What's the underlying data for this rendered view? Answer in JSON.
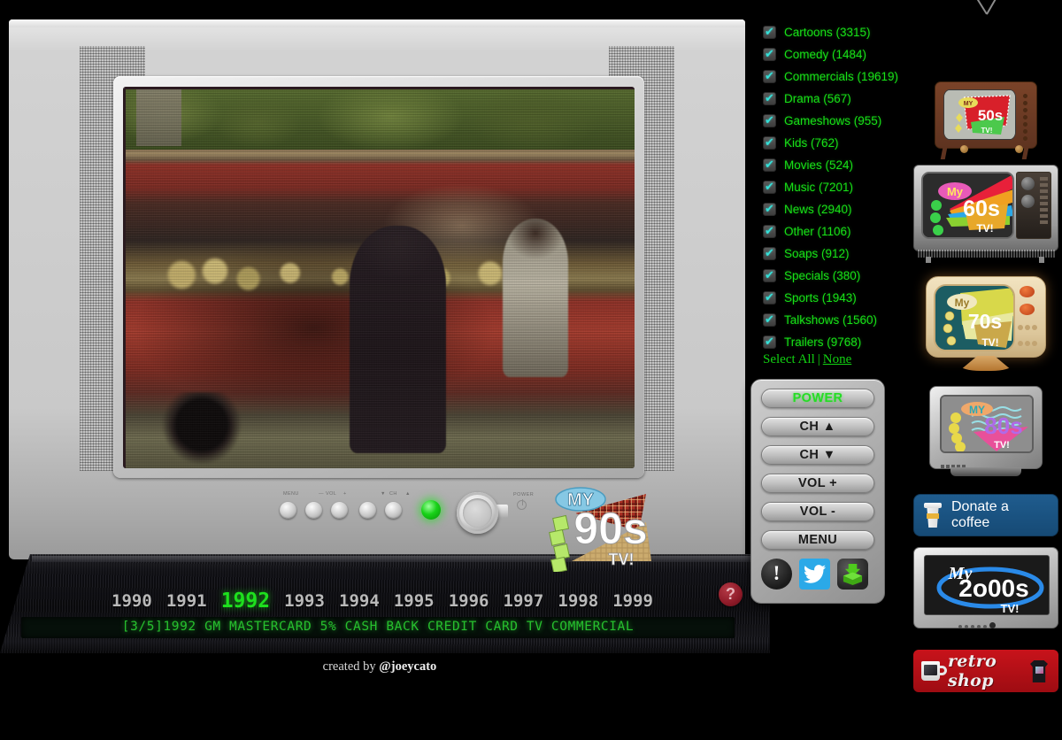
{
  "page": {
    "background_color": "#000000",
    "credit_prefix": "created by ",
    "credit_handle": "@joeycato"
  },
  "tv": {
    "brand_logo": {
      "my": "MY",
      "decade": "90s",
      "tv": "TV!"
    },
    "front_panel": {
      "labels": [
        "-MENU",
        "—  VOL  +",
        "▼   CH   ▲"
      ],
      "label_menu": "MENU",
      "label_vol": "VOL",
      "label_ch": "CH",
      "label_power": "POWER",
      "button_count": 5,
      "led_color": "#19d219",
      "rec_led_color": "#d21a1a"
    },
    "now_playing": "[3/5]1992 GM MASTERCARD 5% CASH BACK CREDIT CARD TV COMMERCIAL",
    "help_label": "?"
  },
  "years": {
    "selected": "1992",
    "items": [
      "1990",
      "1991",
      "1992",
      "1993",
      "1994",
      "1995",
      "1996",
      "1997",
      "1998",
      "1999"
    ],
    "active_color": "#1ee01e",
    "inactive_color": "#b9b9b9"
  },
  "categories": {
    "accent_color": "#18e018",
    "check_color": "#35e0d8",
    "items": [
      {
        "label": "Cartoons (3315)",
        "name": "Cartoons",
        "count": 3315,
        "checked": true
      },
      {
        "label": "Comedy (1484)",
        "name": "Comedy",
        "count": 1484,
        "checked": true
      },
      {
        "label": "Commercials (19619)",
        "name": "Commercials",
        "count": 19619,
        "checked": true
      },
      {
        "label": "Drama (567)",
        "name": "Drama",
        "count": 567,
        "checked": true
      },
      {
        "label": "Gameshows (955)",
        "name": "Gameshows",
        "count": 955,
        "checked": true
      },
      {
        "label": "Kids (762)",
        "name": "Kids",
        "count": 762,
        "checked": true
      },
      {
        "label": "Movies (524)",
        "name": "Movies",
        "count": 524,
        "checked": true
      },
      {
        "label": "Music (7201)",
        "name": "Music",
        "count": 7201,
        "checked": true
      },
      {
        "label": "News (2940)",
        "name": "News",
        "count": 2940,
        "checked": true
      },
      {
        "label": "Other (1106)",
        "name": "Other",
        "count": 1106,
        "checked": true
      },
      {
        "label": "Soaps (912)",
        "name": "Soaps",
        "count": 912,
        "checked": true
      },
      {
        "label": "Specials (380)",
        "name": "Specials",
        "count": 380,
        "checked": true
      },
      {
        "label": "Sports (1943)",
        "name": "Sports",
        "count": 1943,
        "checked": true
      },
      {
        "label": "Talkshows (1560)",
        "name": "Talkshows",
        "count": 1560,
        "checked": true
      },
      {
        "label": "Trailers (9768)",
        "name": "Trailers",
        "count": 9768,
        "checked": true
      }
    ],
    "select_all_label": "Select All",
    "separator": "|",
    "none_label": "None"
  },
  "remote": {
    "buttons": [
      {
        "label": "POWER",
        "name": "power"
      },
      {
        "label": "CH ▲",
        "name": "channel-up"
      },
      {
        "label": "CH ▼",
        "name": "channel-down"
      },
      {
        "label": "VOL +",
        "name": "volume-up"
      },
      {
        "label": "VOL -",
        "name": "volume-down"
      },
      {
        "label": "MENU",
        "name": "menu"
      }
    ],
    "power_color": "#24dd24",
    "icons": [
      {
        "name": "info-icon",
        "glyph": "!"
      },
      {
        "name": "twitter-icon",
        "glyph": "twitter-bird"
      },
      {
        "name": "archive-icon",
        "glyph": "green-archive-box"
      }
    ]
  },
  "sidebar": {
    "channels": [
      {
        "decade": "50s",
        "my": "MY",
        "tv": "TV!",
        "name": "my-50s-tv"
      },
      {
        "decade": "60s",
        "my": "MY",
        "tv": "TV!",
        "name": "my-60s-tv"
      },
      {
        "decade": "70s",
        "my": "MY",
        "tv": "TV!",
        "name": "my-70s-tv"
      },
      {
        "decade": "80s",
        "my": "MY",
        "tv": "TV!",
        "name": "my-80s-tv"
      },
      {
        "decade": "2o00s",
        "my": "My",
        "tv": "TV!",
        "name": "my-2000s-tv"
      }
    ],
    "donate": {
      "label": "Donate a coffee",
      "color": "#1f5c8e"
    },
    "shop": {
      "label": "retro shop",
      "color": "#c8131b"
    }
  }
}
